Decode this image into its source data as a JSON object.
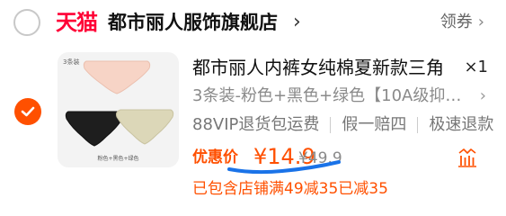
{
  "store": {
    "brand_logo_text": "天猫",
    "name": "都市丽人服饰旗舰店",
    "chevron": "›",
    "coupon_label": "领券",
    "coupon_chevron": "›"
  },
  "item": {
    "selected": true,
    "image": {
      "tag": "3条装",
      "caption": "粉色+黑色+绿色"
    },
    "title": "都市丽人内裤女纯棉夏新款三角",
    "quantity": "×1",
    "sku": "3条装-粉色+黑色+绿色【10A级抑…",
    "sku_chevron": "›",
    "services": [
      "88VIP退货包运费",
      "假一赔四",
      "极速退款"
    ],
    "price_label": "优惠价",
    "price": "¥14.9",
    "original_price": "¥49.9",
    "promo": "已包含店铺满49减35已减35"
  },
  "colors": {
    "accent": "#ff5000",
    "tmall_red": "#ff0036",
    "annotation_blue": "#1a73e8"
  },
  "icons": {
    "store_checkbox": "empty-circle-icon",
    "item_checkbox": "checked-circle-icon",
    "promo": "discount-bars-icon"
  }
}
